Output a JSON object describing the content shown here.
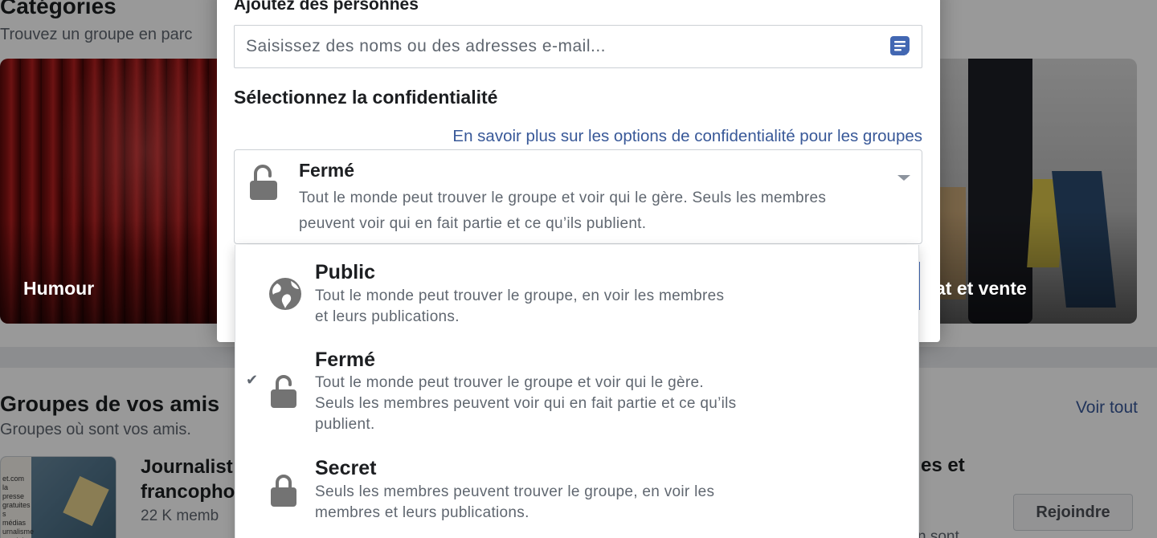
{
  "categories": {
    "title": "Catégories",
    "subtitle": "Trouvez un groupe en parc"
  },
  "category_cards": [
    {
      "label": "Humour"
    },
    {
      "label": "at et vente"
    }
  ],
  "friends_groups": {
    "title": "Groupes de vos amis",
    "subtitle": "Groupes où sont vos amis.",
    "see_all": "Voir tout",
    "group": {
      "thumb_text": "et.com\nla presse\ngratuites\ns médias\nurnalisme\nemploi",
      "name": "Journalist\nfrancopho",
      "members": "22 K memb"
    },
    "group_right": {
      "name_fragment": "es et",
      "sub_fragment": "n sont",
      "join_label": "Rejoindre"
    }
  },
  "modal": {
    "add_people_label": "Ajoutez des personnes",
    "people_input_placeholder": "Saisissez des noms ou des adresses e-mail...",
    "privacy_label": "Sélectionnez la confidentialité",
    "privacy_link": "En savoir plus sur les options de confidentialité pour les groupes",
    "selected": {
      "title": "Fermé",
      "description": "Tout le monde peut trouver le groupe et voir qui le gère. Seuls les membres peuvent voir qui en fait partie et ce qu’ils publient."
    }
  },
  "privacy_menu": {
    "options": [
      {
        "title": "Public",
        "description": "Tout le monde peut trouver le groupe, en voir les membres et leurs publications.",
        "icon": "globe-icon",
        "checked": false
      },
      {
        "title": "Fermé",
        "description": "Tout le monde peut trouver le groupe et voir qui le gère. Seuls les membres peuvent voir qui en fait partie et ce qu’ils publient.",
        "icon": "unlocked-padlock-icon",
        "checked": true
      },
      {
        "title": "Secret",
        "description": "Seuls les membres peuvent trouver le groupe, en voir les membres et leurs publications.",
        "icon": "locked-padlock-icon",
        "checked": false
      }
    ],
    "check_glyph": "✔"
  },
  "colors": {
    "link": "#385898",
    "primary": "#4267b2",
    "text_secondary": "#606770",
    "icon_gray": "#737373"
  }
}
